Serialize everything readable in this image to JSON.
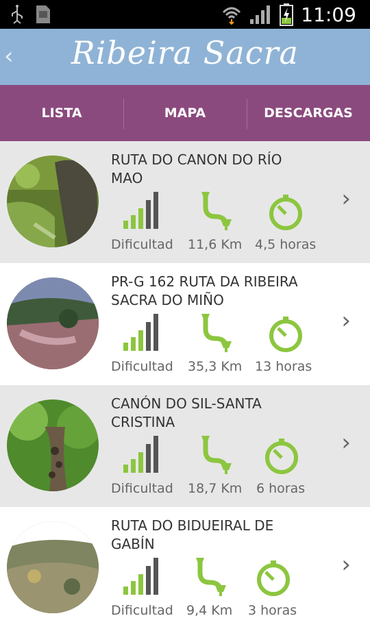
{
  "status": {
    "time": "11:09"
  },
  "app": {
    "title": "Ribeira Sacra",
    "back_label": "‹"
  },
  "tabs": [
    {
      "label": "LISTA"
    },
    {
      "label": "MAPA"
    },
    {
      "label": "DESCARGAS"
    }
  ],
  "routes": [
    {
      "name": "RUTA DO CANON DO RÍO MAO",
      "difficulty_label": "Dificultad",
      "distance": "11,6 Km",
      "duration": "4,5 horas"
    },
    {
      "name": "PR-G 162 RUTA DA RIBEIRA SACRA DO MIÑO",
      "difficulty_label": "Dificultad",
      "distance": "35,3 Km",
      "duration": "13 horas"
    },
    {
      "name": "CANÓN DO SIL-SANTA CRISTINA",
      "difficulty_label": "Dificultad",
      "distance": "18,7 Km",
      "duration": "6 horas"
    },
    {
      "name": "RUTA DO BIDUEIRAL DE GABÍN",
      "difficulty_label": "Dificultad",
      "distance": "9,4 Km",
      "duration": "3 horas"
    }
  ],
  "colors": {
    "appbar": "#8fb3d6",
    "tabs": "#8b4a7e",
    "accent_green": "#8cc63f",
    "row_gray": "#e7e7e7"
  }
}
